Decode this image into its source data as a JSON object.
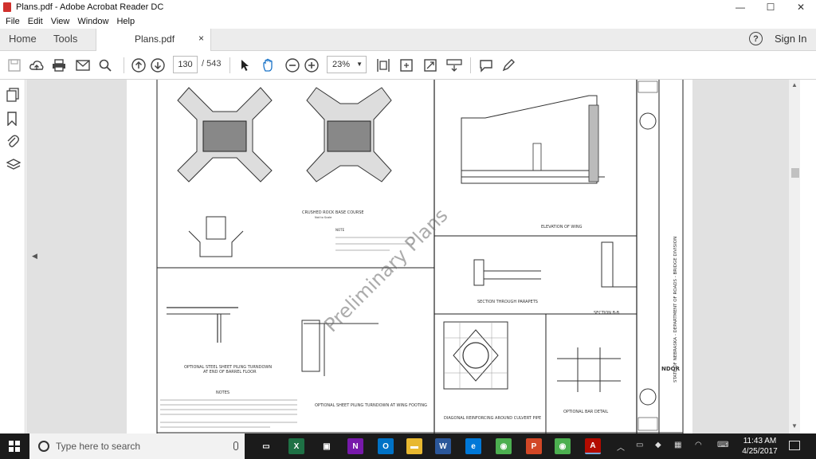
{
  "window": {
    "title": "Plans.pdf - Adobe Acrobat Reader DC",
    "minimize": "—",
    "maximize": "☐",
    "close": "✕"
  },
  "menu": {
    "items": [
      "File",
      "Edit",
      "View",
      "Window",
      "Help"
    ]
  },
  "tabs": {
    "home": "Home",
    "tools": "Tools",
    "document": "Plans.pdf",
    "close": "×"
  },
  "header": {
    "help": "?",
    "signin": "Sign In"
  },
  "toolbar": {
    "current_page": "130",
    "page_separator": "/ 543",
    "zoom": "23%"
  },
  "drawing": {
    "watermark": "Preliminary Plans",
    "labels": {
      "crushed_rock": "CRUSHED ROCK BASE COURSE",
      "not_to_scale": "Not to Scale",
      "note": "NOTE",
      "elevation_wing": "ELEVATION OF WING",
      "section_parapets": "SECTION THROUGH PARAPETS",
      "section_bb": "SECTION B-B",
      "optional_steel": "OPTIONAL STEEL SHEET PILING TURNDOWN",
      "at_end_barrel": "AT END OF BARREL FLOOR",
      "notes": "NOTES",
      "optional_wing": "OPTIONAL SHEET PILING TURNDOWN AT WING FOOTING",
      "diagonal_reinf": "DIAGONAL REINFORCING AROUND CULVERT PIPE",
      "optional_bar": "OPTIONAL BAR DETAIL",
      "state": "STATE OF NEBRASKA - DEPARTMENT OF ROADS - BRIDGE DIVISION",
      "ndor": "NDOR"
    }
  },
  "taskbar": {
    "search_placeholder": "Type here to search",
    "time": "11:43 AM",
    "date": "4/25/2017",
    "apps": [
      {
        "name": "task-view",
        "color": "#1b1b1b",
        "glyph": "▭"
      },
      {
        "name": "excel",
        "color": "#1e7145",
        "glyph": "X"
      },
      {
        "name": "store",
        "color": "#1b1b1b",
        "glyph": "▣"
      },
      {
        "name": "onenote",
        "color": "#7719aa",
        "glyph": "N"
      },
      {
        "name": "outlook",
        "color": "#0072c6",
        "glyph": "O"
      },
      {
        "name": "file-explorer",
        "color": "#e8b830",
        "glyph": "▬"
      },
      {
        "name": "word",
        "color": "#2b579a",
        "glyph": "W"
      },
      {
        "name": "edge",
        "color": "#0078d7",
        "glyph": "e"
      },
      {
        "name": "chrome",
        "color": "#4caf50",
        "glyph": "◉"
      },
      {
        "name": "powerpoint",
        "color": "#d24726",
        "glyph": "P"
      },
      {
        "name": "chrome-2",
        "color": "#4caf50",
        "glyph": "◉"
      },
      {
        "name": "acrobat",
        "color": "#b30b00",
        "glyph": "A"
      }
    ]
  }
}
